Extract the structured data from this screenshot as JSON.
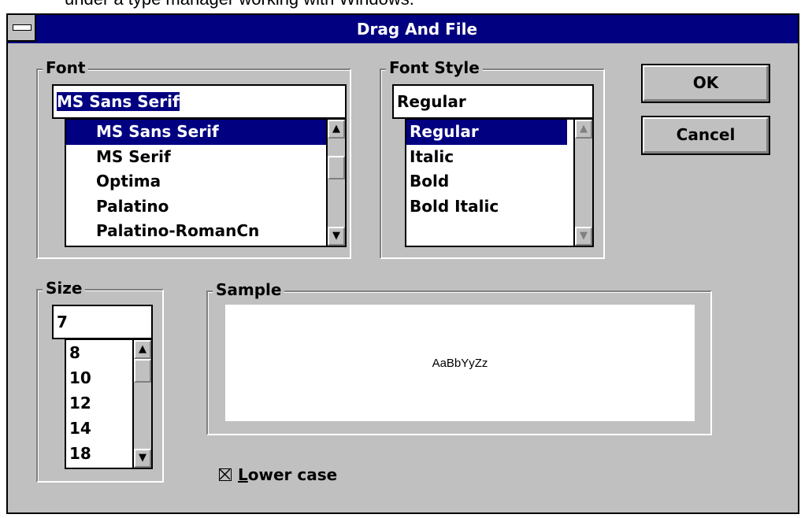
{
  "top_clip_text": "under a type manager working with Windows.",
  "window": {
    "title": "Drag And File"
  },
  "font_group": {
    "label": "Font",
    "value": "MS Sans Serif",
    "items": [
      "MS Sans Serif",
      "MS Serif",
      "Optima",
      "Palatino",
      "Palatino-RomanCn"
    ],
    "selected_index": 0
  },
  "style_group": {
    "label": "Font Style",
    "value": "Regular",
    "items": [
      "Regular",
      "Italic",
      "Bold",
      "Bold Italic"
    ],
    "selected_index": 0
  },
  "size_group": {
    "label": "Size",
    "value": "7",
    "items": [
      "8",
      "10",
      "12",
      "14",
      "18"
    ]
  },
  "sample_group": {
    "label": "Sample",
    "text": "AaBbYyZz"
  },
  "buttons": {
    "ok": "OK",
    "cancel": "Cancel"
  },
  "checkbox": {
    "accel": "L",
    "rest": "ower case",
    "checked": true
  },
  "icons": {
    "scroll_up": "arrow-up-icon",
    "scroll_down": "arrow-down-icon",
    "system_menu": "system-menu-icon"
  }
}
